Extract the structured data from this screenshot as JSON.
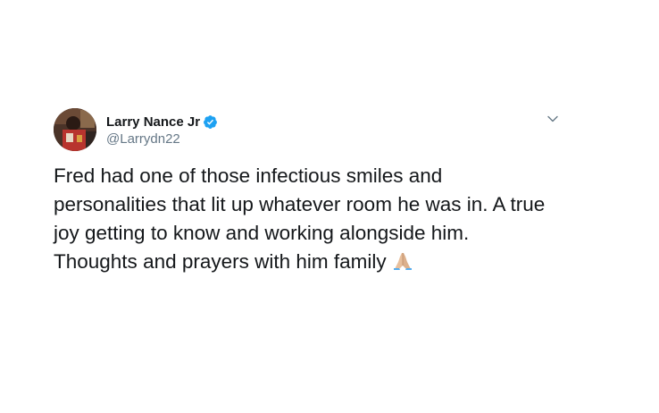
{
  "tweet": {
    "author": {
      "display_name": "Larry Nance Jr",
      "handle": "@Larrydn22",
      "verified": true
    },
    "text": "Fred had one of those infectious smiles and\npersonalities that lit up whatever room he was in. A true\njoy getting to know and working alongside him.\nThoughts and prayers with him family",
    "emoji": "folded-hands",
    "icons": {
      "verified": "verified-badge-icon",
      "menu": "chevron-down-icon"
    },
    "colors": {
      "verified_blue": "#1da1f2",
      "handle_gray": "#657786",
      "text": "#14171a"
    }
  }
}
